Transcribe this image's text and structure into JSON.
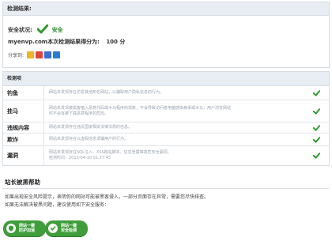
{
  "result": {
    "header": "检测结果:",
    "status_label": "安全状况:",
    "status_value": "安全",
    "score_text": "myenvp.com本次检测结果得分为:",
    "score_value": "100 分",
    "share_label": "分享到:",
    "share_icons": [
      "qzone-icon",
      "tsina-icon",
      "baidu-icon",
      "renren-icon"
    ]
  },
  "details": {
    "header": "检测项",
    "rows": [
      {
        "category": "钓鱼",
        "desc": [
          "网站未发现存在仿冒其他知名网站，以骗取用户隐私信息的行为。"
        ],
        "status": "check-icon"
      },
      {
        "category": "挂马",
        "desc": [
          "网站未发现被黑客植入恶意代码或木马程序的现象，不会导致访问者电脑感染病毒或木马，用户浏览网站",
          "时不会有被下载恶意程序的危险。"
        ],
        "status": "check-icon"
      },
      {
        "category": "违规内容",
        "desc": [
          "网站未发现存在违反国家相关法律法规的信息。"
        ],
        "status": "check-icon"
      },
      {
        "category": "欺诈",
        "desc": [
          "网站未发现存在以虚假信息诱骗用户的行为。"
        ],
        "status": "check-icon"
      },
      {
        "category": "漏洞",
        "desc": [
          "网站未发现存在SQL注入、XSS跨站脚本、信息泄露等高危安全漏洞。",
          "检测时间：2013-04-10 01:27:45"
        ],
        "status": "check-icon"
      }
    ]
  },
  "help": {
    "title": "站长被黑帮助",
    "line1": "如果出现安全风险提示，表明你的网站可能被黑客侵入，一部分页面存在异常，需要您尽快排查。",
    "line2": "如果无法解决被黑问题，建议使用如下安全服务：",
    "buttons": [
      {
        "line1": "网站一键",
        "line2": "防护加速"
      },
      {
        "line1": "网站一键",
        "line2": "安全检测"
      }
    ]
  },
  "colors": {
    "accent_green": "#3f9e3b",
    "header_bg": "#e7edf3",
    "check_green": "#2e9a2e"
  }
}
